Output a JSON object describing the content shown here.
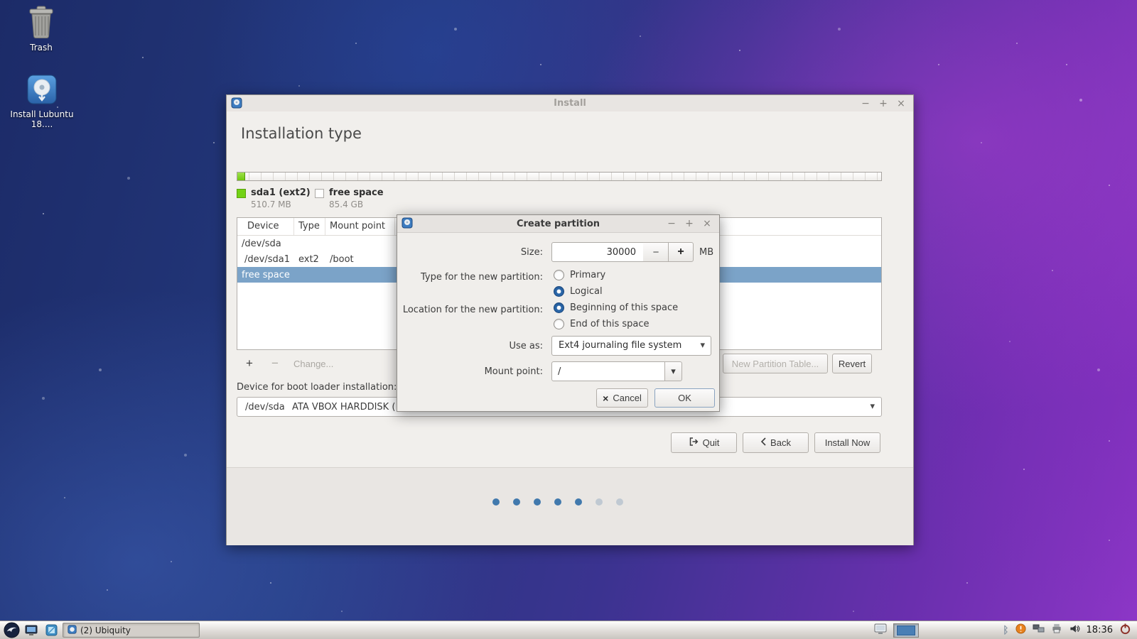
{
  "desktop": {
    "icons": [
      {
        "label": "Trash"
      },
      {
        "label": "Install Lubuntu 18...."
      }
    ]
  },
  "install_window": {
    "titlebar": {
      "title": "Install",
      "minimize": "−",
      "maximize": "+",
      "close": "×"
    },
    "heading": "Installation type",
    "legend": [
      {
        "label": "sda1 (ext2)",
        "size": "510.7 MB",
        "color": "#73d216"
      },
      {
        "label": "free space",
        "size": "85.4 GB",
        "color": "#ffffff"
      }
    ],
    "table": {
      "headers": [
        "Device",
        "Type",
        "Mount point"
      ],
      "rows": [
        {
          "device": "/dev/sda",
          "type": "",
          "mount": "",
          "selected": false
        },
        {
          "device": "/dev/sda1",
          "type": "ext2",
          "mount": "/boot",
          "selected": false
        },
        {
          "device": "free space",
          "type": "",
          "mount": "",
          "selected": true
        }
      ]
    },
    "partition_actions": {
      "add": "+",
      "remove": "−",
      "change": "Change...",
      "new_partition_table": "New Partition Table...",
      "revert": "Revert"
    },
    "bootloader": {
      "label": "Device for boot loader installation:",
      "device": "/dev/sda",
      "description": "ATA VBOX HARDDISK ("
    },
    "nav": {
      "quit": "Quit",
      "back": "Back",
      "install_now": "Install Now"
    },
    "slideshow": {
      "total_dots": 7,
      "active_dots": 5
    }
  },
  "create_partition_dialog": {
    "titlebar": {
      "title": "Create partition",
      "minimize": "−",
      "maximize": "+",
      "close": "×"
    },
    "size": {
      "label": "Size:",
      "value": "30000",
      "unit": "MB"
    },
    "partition_type": {
      "label": "Type for the new partition:",
      "options": [
        {
          "label": "Primary",
          "selected": false
        },
        {
          "label": "Logical",
          "selected": true
        }
      ]
    },
    "location": {
      "label": "Location for the new partition:",
      "options": [
        {
          "label": "Beginning of this space",
          "selected": true
        },
        {
          "label": "End of this space",
          "selected": false
        }
      ]
    },
    "use_as": {
      "label": "Use as:",
      "value": "Ext4 journaling file system"
    },
    "mount_point": {
      "label": "Mount point:",
      "value": "/"
    },
    "buttons": {
      "cancel": "Cancel",
      "ok": "OK"
    }
  },
  "taskbar": {
    "task_button": "(2) Ubiquity",
    "clock": "18:36"
  },
  "colors": {
    "selection": "#7ba3c8",
    "partition_used": "#73d216",
    "radio_active": "#2a66a8",
    "dot_active": "#4179ad",
    "dot_inactive": "#c0c9d2"
  }
}
